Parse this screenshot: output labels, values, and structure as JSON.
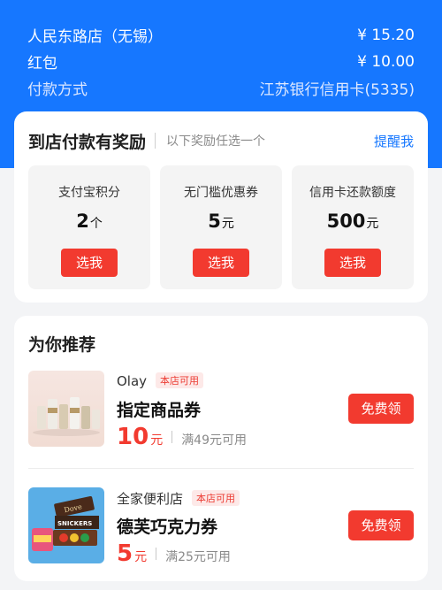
{
  "summary": {
    "store_label": "人民东路店（无锡）",
    "store_amount": "¥ 15.20",
    "redpacket_label": "红包",
    "redpacket_amount": "¥ 10.00",
    "payment_label": "付款方式",
    "payment_value": "江苏银行信用卡(5335)"
  },
  "reward": {
    "title": "到店付款有奖励",
    "subtitle": "以下奖励任选一个",
    "remind_link": "提醒我",
    "options": [
      {
        "name": "支付宝积分",
        "value": "2",
        "unit": "个",
        "button": "选我"
      },
      {
        "name": "无门槛优惠券",
        "value": "5",
        "unit": "元",
        "button": "选我"
      },
      {
        "name": "信用卡还款额度",
        "value": "500",
        "unit": "元",
        "button": "选我"
      }
    ]
  },
  "recommend": {
    "title": "为你推荐",
    "items": [
      {
        "store": "Olay",
        "tag": "本店可用",
        "coupon": "指定商品券",
        "amount": "10",
        "unit": "元",
        "condition": "满49元可用",
        "button": "免费领"
      },
      {
        "store": "全家便利店",
        "tag": "本店可用",
        "coupon": "德芙巧克力券",
        "amount": "5",
        "unit": "元",
        "condition": "满25元可用",
        "button": "免费领"
      }
    ]
  },
  "colors": {
    "brand_blue": "#1677ff",
    "action_red": "#f23a2f"
  }
}
